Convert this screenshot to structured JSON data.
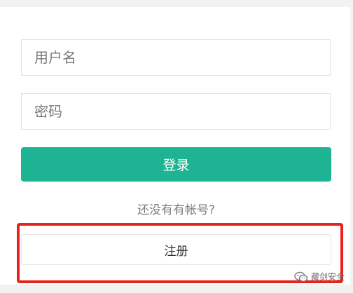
{
  "login_form": {
    "username_placeholder": "用户名",
    "password_placeholder": "密码",
    "login_label": "登录",
    "no_account_text": "还没有有帐号?",
    "register_label": "注册"
  },
  "watermark": {
    "text": "藏剑安全",
    "icon": "wechat-icon"
  },
  "colors": {
    "primary": "#1db393",
    "highlight": "#e8221c"
  }
}
